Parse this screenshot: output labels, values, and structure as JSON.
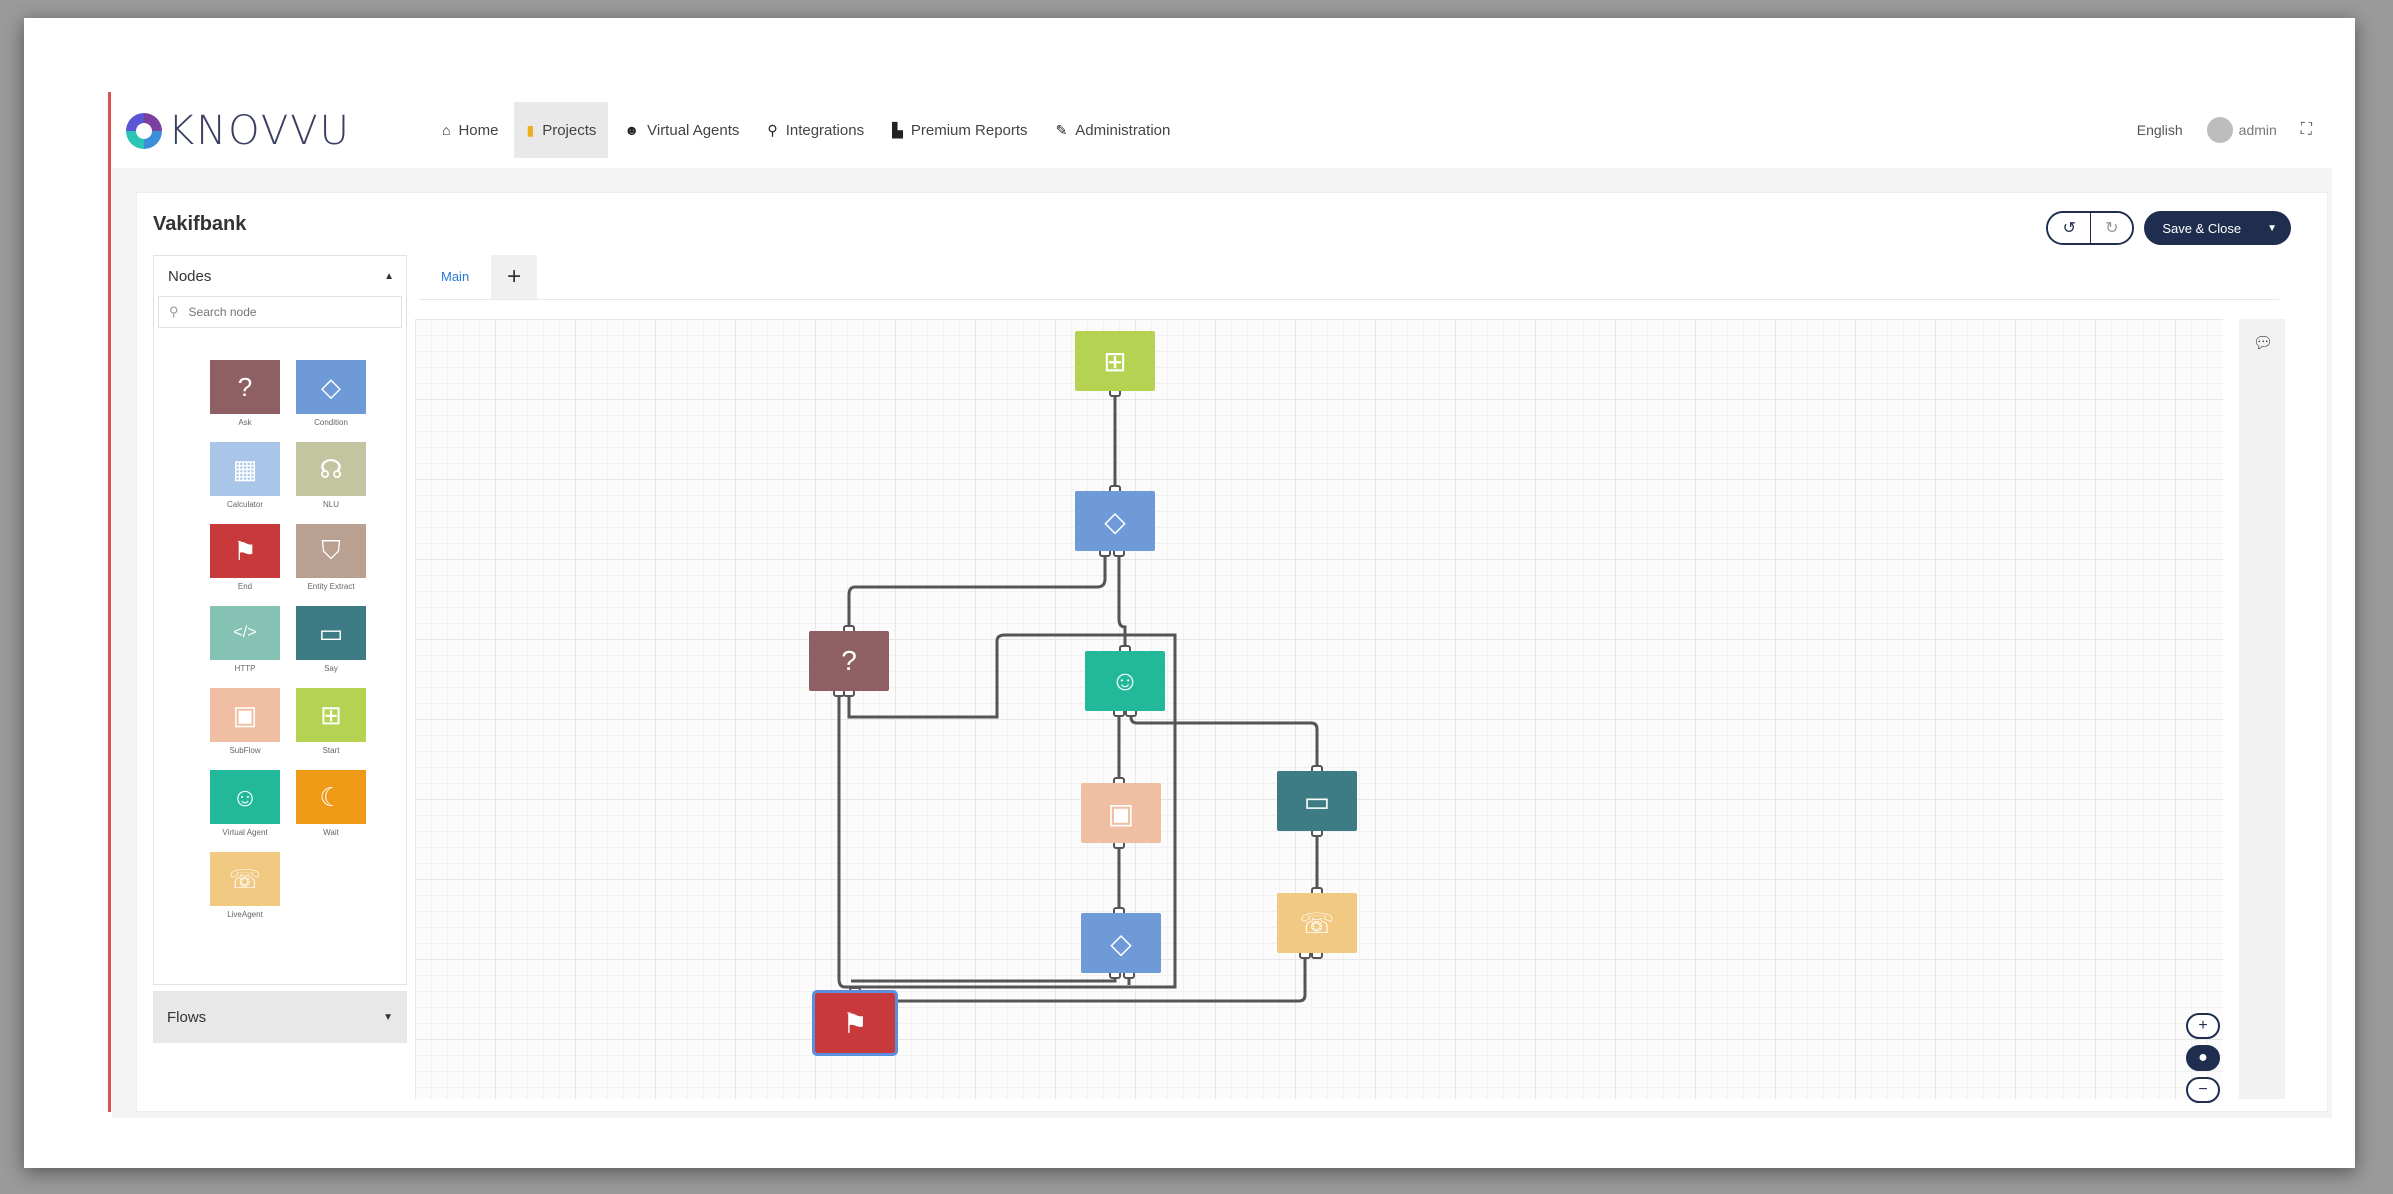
{
  "brand": {
    "name": "KNOVVU"
  },
  "nav": {
    "items": [
      {
        "label": "Home",
        "icon": "home-icon",
        "glyph": "⌂"
      },
      {
        "label": "Projects",
        "icon": "projects-icon",
        "glyph": "▮"
      },
      {
        "label": "Virtual Agents",
        "icon": "users-icon",
        "glyph": "☻"
      },
      {
        "label": "Integrations",
        "icon": "plug-icon",
        "glyph": "⚲"
      },
      {
        "label": "Premium Reports",
        "icon": "chart-icon",
        "glyph": "▙"
      },
      {
        "label": "Administration",
        "icon": "wrench-icon",
        "glyph": "✎"
      }
    ],
    "active": "Projects"
  },
  "topright": {
    "language": "English",
    "username": "admin"
  },
  "project": {
    "title": "Vakifbank"
  },
  "toolbar": {
    "save_label": "Save & Close"
  },
  "sidebar": {
    "nodes_title": "Nodes",
    "search_placeholder": "Search node",
    "palette": [
      {
        "label": "Ask",
        "color": "#8e5f63",
        "glyph": "?"
      },
      {
        "label": "Condition",
        "color": "#6f9ad8",
        "glyph": "◇"
      },
      {
        "label": "Calculator",
        "color": "#a9c6e8",
        "glyph": "▦"
      },
      {
        "label": "NLU",
        "color": "#c2c5a0",
        "glyph": "☊"
      },
      {
        "label": "End",
        "color": "#c8393c",
        "glyph": "⚑"
      },
      {
        "label": "Entity Extract",
        "color": "#b9a090",
        "glyph": "⛉"
      },
      {
        "label": "HTTP",
        "color": "#86c2b3",
        "glyph": "</>"
      },
      {
        "label": "Say",
        "color": "#3d7c84",
        "glyph": "▭"
      },
      {
        "label": "SubFlow",
        "color": "#f0bfa3",
        "glyph": "▣"
      },
      {
        "label": "Start",
        "color": "#b6d252",
        "glyph": "⊞"
      },
      {
        "label": "Virtual Agent",
        "color": "#22b99a",
        "glyph": "☺"
      },
      {
        "label": "Wait",
        "color": "#ef9a17",
        "glyph": "☾"
      },
      {
        "label": "LiveAgent",
        "color": "#f2c983",
        "glyph": "☏"
      }
    ],
    "flows_title": "Flows"
  },
  "tabs": [
    {
      "label": "Main"
    }
  ],
  "canvas_nodes": [
    {
      "type": "start",
      "color": "#b6d252",
      "glyph": "⊞"
    },
    {
      "type": "condition",
      "color": "#6f9ad8",
      "glyph": "◇"
    },
    {
      "type": "ask",
      "color": "#8e5f63",
      "glyph": "?"
    },
    {
      "type": "virtual-agent",
      "color": "#22b99a",
      "glyph": "☺"
    },
    {
      "type": "subflow",
      "color": "#f0bfa3",
      "glyph": "▣"
    },
    {
      "type": "say",
      "color": "#3d7c84",
      "glyph": "▭"
    },
    {
      "type": "condition",
      "color": "#6f9ad8",
      "glyph": "◇"
    },
    {
      "type": "liveagent",
      "color": "#f2c983",
      "glyph": "☏"
    },
    {
      "type": "end",
      "color": "#c8393c",
      "glyph": "⚑"
    }
  ]
}
